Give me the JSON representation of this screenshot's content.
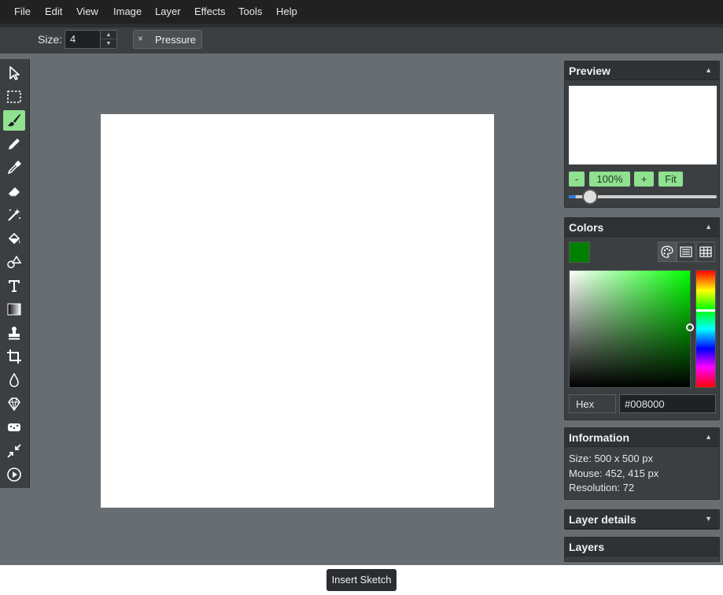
{
  "menu": {
    "items": [
      "File",
      "Edit",
      "View",
      "Image",
      "Layer",
      "Effects",
      "Tools",
      "Help"
    ]
  },
  "tool_attributes": {
    "size_label": "Size:",
    "size_value": "4",
    "pressure_label": "Pressure",
    "pressure_close": "×"
  },
  "tools": [
    {
      "name": "select-tool",
      "icon": "cursor-arrow-icon",
      "active": false
    },
    {
      "name": "selection-tool",
      "icon": "dashed-rectangle-icon",
      "active": false
    },
    {
      "name": "brush-tool",
      "icon": "paintbrush-icon",
      "active": true
    },
    {
      "name": "pencil-tool",
      "icon": "pencil-icon",
      "active": false
    },
    {
      "name": "color-picker-tool",
      "icon": "eyedropper-icon",
      "active": false
    },
    {
      "name": "erase-tool",
      "icon": "eraser-icon",
      "active": false
    },
    {
      "name": "magic-erase-tool",
      "icon": "magic-wand-icon",
      "active": false
    },
    {
      "name": "fill-tool",
      "icon": "paint-bucket-icon",
      "active": false
    },
    {
      "name": "shape-tool",
      "icon": "shapes-icon",
      "active": false
    },
    {
      "name": "text-tool",
      "icon": "text-T-icon",
      "active": false
    },
    {
      "name": "gradient-tool",
      "icon": "gradient-icon",
      "active": false
    },
    {
      "name": "clone-tool",
      "icon": "stamp-icon",
      "active": false
    },
    {
      "name": "crop-tool",
      "icon": "crop-icon",
      "active": false
    },
    {
      "name": "blur-tool",
      "icon": "drop-icon",
      "active": false
    },
    {
      "name": "sharpen-tool",
      "icon": "diamond-icon",
      "active": false
    },
    {
      "name": "desaturate-tool",
      "icon": "sponge-icon",
      "active": false
    },
    {
      "name": "bulge-pinch-tool",
      "icon": "compress-arrows-icon",
      "active": false
    },
    {
      "name": "animation-tool",
      "icon": "play-circle-icon",
      "active": false
    }
  ],
  "canvas": {
    "color": "#ffffff"
  },
  "preview_panel": {
    "title": "Preview",
    "zoom_out": "-",
    "zoom_level": "100%",
    "zoom_in": "+",
    "fit": "Fit",
    "zoom_slider_fraction": 0.05
  },
  "colors_panel": {
    "title": "Colors",
    "current_color": "#008000",
    "hex_label": "Hex",
    "hex_value": "#008000"
  },
  "information_panel": {
    "title": "Information",
    "size": "Size: 500 x 500 px",
    "mouse": "Mouse: 452, 415 px",
    "resolution": "Resolution: 72"
  },
  "layer_details_panel": {
    "title": "Layer details"
  },
  "layers_panel": {
    "title": "Layers"
  },
  "bottom": {
    "insert_sketch": "Insert Sketch"
  },
  "theme": {
    "accent": "#8fe08f",
    "menubar": "#212121",
    "workspace": "#676d70",
    "panel": "#3b3f42"
  }
}
